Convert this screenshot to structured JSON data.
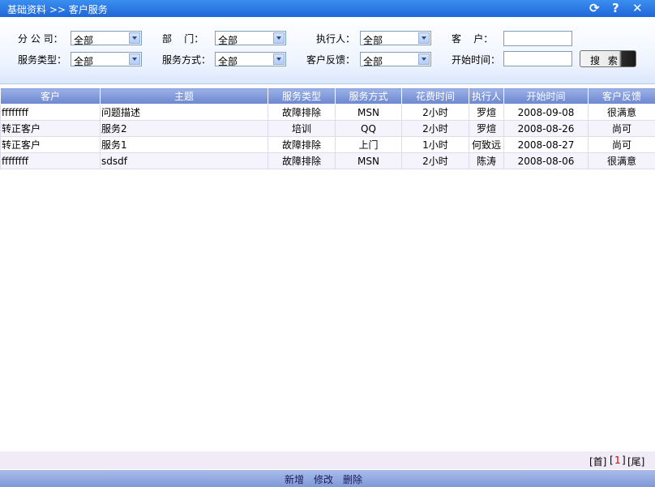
{
  "window": {
    "title": "基础资料 >> 客户服务",
    "controls": [
      "refresh-icon",
      "help-icon",
      "close-icon"
    ]
  },
  "filters": {
    "branch": {
      "label": "分 公 司：",
      "value": "全部"
    },
    "department": {
      "label": "部    门：",
      "value": "全部"
    },
    "executor": {
      "label": "执行人：",
      "value": "全部"
    },
    "customer": {
      "label": "客    户：",
      "value": ""
    },
    "service_type": {
      "label": "服务类型：",
      "value": "全部"
    },
    "service_method": {
      "label": "服务方式：",
      "value": "全部"
    },
    "feedback": {
      "label": "客户反馈：",
      "value": "全部"
    },
    "start_time": {
      "label": "开始时间：",
      "value": ""
    },
    "search_button": "搜 索"
  },
  "table": {
    "headers": [
      "客户",
      "主题",
      "服务类型",
      "服务方式",
      "花费时间",
      "执行人",
      "开始时间",
      "客户反馈"
    ],
    "rows": [
      [
        "ffffffff",
        "问题描述",
        "故障排除",
        "MSN",
        "2小时",
        "罗煊",
        "2008-09-08",
        "很满意"
      ],
      [
        "转正客户",
        "服务2",
        "培训",
        "QQ",
        "2小时",
        "罗煊",
        "2008-08-26",
        "尚可"
      ],
      [
        "转正客户",
        "服务1",
        "故障排除",
        "上门",
        "1小时",
        "何致远",
        "2008-08-27",
        "尚可"
      ],
      [
        "ffffffff",
        "sdsdf",
        "故障排除",
        "MSN",
        "2小时",
        "陈涛",
        "2008-08-06",
        "很满意"
      ]
    ]
  },
  "pager": {
    "first": "[首]",
    "current": "1",
    "current_open": "[",
    "current_close": "]",
    "last": "[尾]",
    "current_color": "#cc0000"
  },
  "actions": {
    "add": "新增",
    "edit": "修改",
    "delete": "删除"
  },
  "colors": {
    "title_bar": "#1e66d8",
    "header": "#7b94d6",
    "row_alt": "#f5f3fb"
  }
}
